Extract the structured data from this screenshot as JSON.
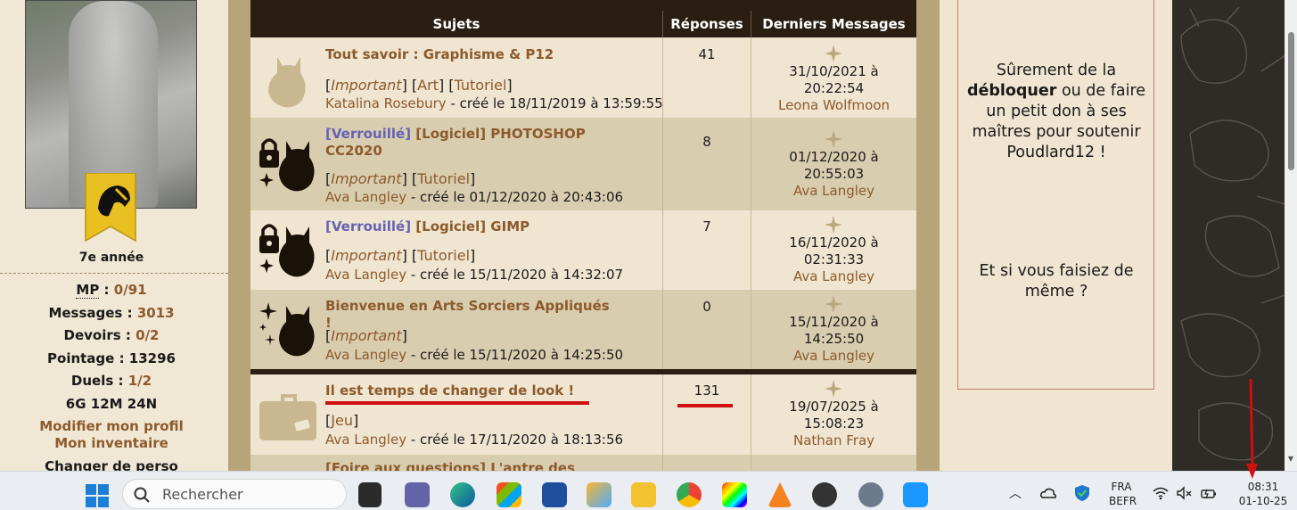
{
  "profile": {
    "rank": "7e année",
    "stats": [
      {
        "label": "MP",
        "sep": " : ",
        "value": "0/91"
      },
      {
        "label": "Messages",
        "sep": " : ",
        "value": "3013"
      },
      {
        "label": "Devoirs",
        "sep": " : ",
        "value": "0/2"
      },
      {
        "label": "Pointage",
        "sep": " : ",
        "value": "13296"
      },
      {
        "label": "Duels",
        "sep": " : ",
        "value": "1/2"
      }
    ],
    "currency": "6G 12M 24N",
    "links": [
      "Modifier mon profil",
      "Mon inventaire",
      "Changer de perso"
    ]
  },
  "table": {
    "headers": {
      "subjects": "Sujets",
      "replies": "Réponses",
      "last": "Derniers Messages"
    },
    "rows": [
      {
        "icon": "owl-icon",
        "prefix": "",
        "title": "Tout savoir : Graphisme & P12",
        "title_line2": "",
        "tags": [
          "Important",
          "Art",
          "Tutoriel"
        ],
        "author": "Katalina Rosebury",
        "created": " - créé le 18/11/2019 à 13:59:55",
        "replies": "41",
        "last_date": "31/10/2021 à",
        "last_time": "20:22:54",
        "last_user": "Leona Wolfmoon"
      },
      {
        "icon": "locked-owl-icon",
        "prefix": "[Verrouillé]",
        "title": " [Logiciel] PHOTOSHOP",
        "title_line2": "CC2020",
        "tags": [
          "Important",
          "Tutoriel"
        ],
        "author": "Ava Langley",
        "created": " - créé le 01/12/2020 à 20:43:06",
        "replies": "8",
        "last_date": "01/12/2020 à",
        "last_time": "20:55:03",
        "last_user": "Ava Langley"
      },
      {
        "icon": "locked-owl-icon",
        "prefix": "[Verrouillé]",
        "title": " [Logiciel] GIMP",
        "title_line2": "",
        "tags": [
          "Important",
          "Tutoriel"
        ],
        "author": "Ava Langley",
        "created": " - créé le 15/11/2020 à 14:32:07",
        "replies": "7",
        "last_date": "16/11/2020 à",
        "last_time": "02:31:33",
        "last_user": "Ava Langley"
      },
      {
        "icon": "sparkle-owl-icon",
        "prefix": "",
        "title": "Bienvenue en Arts Sorciers Appliqués !",
        "title_line2": "",
        "tags": [
          "Important"
        ],
        "author": "Ava Langley",
        "created": " - créé le 15/11/2020 à 14:25:50",
        "replies": "0",
        "last_date": "15/11/2020 à",
        "last_time": "14:25:50",
        "last_user": "Ava Langley"
      },
      {
        "icon": "suitcase-icon",
        "prefix": "",
        "title": "Il est temps de changer de look !",
        "title_line2": "",
        "tags": [
          "Jeu"
        ],
        "author": "Ava Langley",
        "created": " - créé le 17/11/2020 à 18:13:56",
        "replies": "131",
        "last_date": "19/07/2025 à",
        "last_time": "15:08:23",
        "last_user": "Nathan Fray"
      }
    ],
    "partial_row": "[Foire aux questions] L'antre des"
  },
  "sidebar_message": {
    "p1_before": "Sûrement de la ",
    "p1_bold": "débloquer",
    "p1_after": " ou de faire un petit don à ses maîtres pour soutenir Poudlard12 !",
    "p2": "Et si vous faisiez de même ?"
  },
  "taskbar": {
    "search_placeholder": "Rechercher",
    "lang_top": "FRA",
    "lang_bottom": "BEFR",
    "time": "08:31",
    "date": "01-10-25"
  }
}
